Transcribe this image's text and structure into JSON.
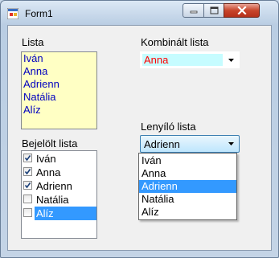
{
  "window": {
    "title": "Form1",
    "controls": [
      "minimize-icon",
      "maximize-icon",
      "close-icon"
    ],
    "colors": {
      "close_button": "#c8452b",
      "frame": "#b9cde3"
    }
  },
  "lista": {
    "label": "Lista",
    "items": [
      "Iván",
      "Anna",
      "Adrienn",
      "Natália",
      "Alíz"
    ],
    "item_color": "#0000c0",
    "background": "#ffffc4"
  },
  "bejelolt": {
    "label": "Bejelölt lista",
    "items": [
      {
        "label": "Iván",
        "checked": true,
        "selected": false
      },
      {
        "label": "Anna",
        "checked": true,
        "selected": false
      },
      {
        "label": "Adrienn",
        "checked": true,
        "selected": false
      },
      {
        "label": "Natália",
        "checked": false,
        "selected": false
      },
      {
        "label": "Alíz",
        "checked": false,
        "selected": true
      }
    ]
  },
  "kombinalt": {
    "label": "Kombinált lista",
    "value": "Anna",
    "text_color": "#ff0000",
    "background": "#c6fcff"
  },
  "lenyilo": {
    "label": "Lenyíló lista",
    "value": "Adrienn",
    "options": [
      "Iván",
      "Anna",
      "Adrienn",
      "Natália",
      "Alíz"
    ],
    "selected_index": 2,
    "highlight_color": "#3399ff"
  }
}
